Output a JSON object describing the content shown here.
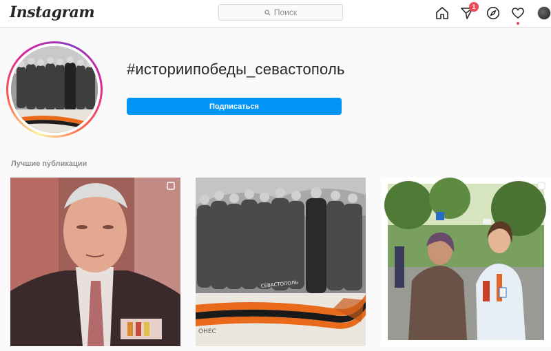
{
  "header": {
    "logo": "Instagram",
    "search_placeholder": "Поиск",
    "direct_badge": "1"
  },
  "icons": {
    "home": "home-icon",
    "direct": "paper-plane-icon",
    "explore": "compass-icon",
    "activity": "heart-icon",
    "profile": "avatar-icon"
  },
  "colors": {
    "accent": "#0095f6",
    "badge": "#ed4956",
    "border": "#dbdbdb",
    "background": "#fafafa"
  },
  "profile": {
    "hashtag": "#историипобеды_севастополь",
    "follow_label": "Подписаться"
  },
  "posts_section": {
    "title": "Лучшие публикации"
  },
  "posts": [
    {
      "photo_text": "",
      "corner": ""
    },
    {
      "photo_text": "СЕВАСТОПОЛЬ",
      "corner": "ОНЕС"
    },
    {
      "photo_text": "",
      "corner": ""
    }
  ]
}
